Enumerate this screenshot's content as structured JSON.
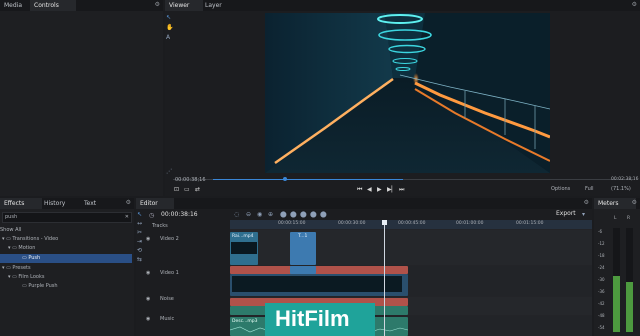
{
  "left_top": {
    "tabs": [
      "Media",
      "Controls"
    ]
  },
  "viewer": {
    "tabs": [
      "Viewer",
      "Layer"
    ],
    "timecode": "00:00:38;16",
    "timecode_right": "00:02:38;16",
    "options_label": "Options",
    "quality_label": "Full",
    "zoom_label": "(71.1%)"
  },
  "effects": {
    "tabs": [
      "Effects",
      "History",
      "Text"
    ],
    "search_value": "push",
    "show_all": "Show All",
    "tree": [
      {
        "label": "Transitions - Video",
        "level": 0
      },
      {
        "label": "Motion",
        "level": 1
      },
      {
        "label": "Push",
        "level": 2,
        "selected": true
      },
      {
        "label": "Presets",
        "level": 0
      },
      {
        "label": "Film Looks",
        "level": 1
      },
      {
        "label": "Purple Push",
        "level": 2
      }
    ]
  },
  "editor": {
    "tab": "Editor",
    "timecode": "00:00:38:16",
    "export_label": "Export",
    "tracks_label": "Tracks",
    "ruler": [
      "00:00:15:00",
      "00:00:30:00",
      "00:00:45:00",
      "00:01:00:00",
      "00:01:15:00"
    ],
    "tracks": [
      {
        "name": "Video 2"
      },
      {
        "name": "Video 1"
      },
      {
        "name": "Noise"
      },
      {
        "name": "Music"
      }
    ],
    "clips": {
      "v2a": "Rai...mp4",
      "v2b": "T...1",
      "audio": "Desc...mp3"
    }
  },
  "meters": {
    "tab": "Meters",
    "channels": [
      "L",
      "R"
    ],
    "scale": [
      "-6",
      "-12",
      "-18",
      "-24",
      "-30",
      "-36",
      "-42",
      "-48",
      "-54"
    ]
  },
  "watermark": "HitFilm",
  "colors": {
    "accent": "#3a86d6",
    "clip_blue": "#2f6f8f",
    "clip_teal": "#2d7a6b",
    "clip_red": "#b0524a",
    "watermark_bg": "#1fa39a"
  }
}
